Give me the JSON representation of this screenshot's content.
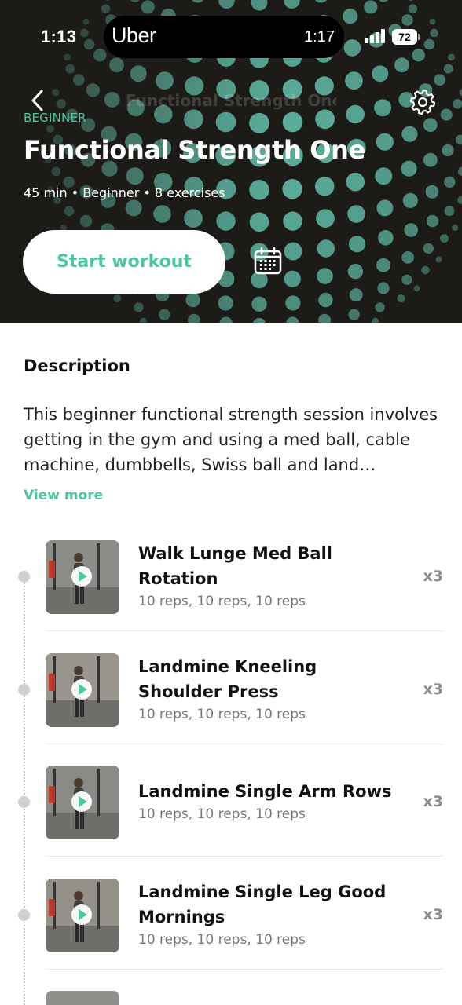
{
  "status_bar": {
    "time_left": "1:13",
    "app_logo": "Uber",
    "island_time": "1:17",
    "battery": "72"
  },
  "header": {
    "back_icon": "chevron-left-icon",
    "faded_title": "Functional Strength One",
    "settings_icon": "gear-icon"
  },
  "workout": {
    "level": "BEGINNER",
    "title": "Functional Strength One",
    "meta": "45 min • Beginner • 8 exercises",
    "start_label": "Start workout",
    "calendar_icon": "calendar-icon"
  },
  "description": {
    "heading": "Description",
    "text": "This beginner functional strength session involves getting in the gym and using a med ball, cable machine, dumbbells, Swiss ball and land…",
    "view_more": "View more"
  },
  "exercises": [
    {
      "name": "Walk Lunge Med Ball Rotation",
      "reps": "10 reps, 10 reps, 10 reps",
      "sets": "x3"
    },
    {
      "name": "Landmine Kneeling Shoulder Press",
      "reps": "10 reps, 10 reps, 10 reps",
      "sets": "x3"
    },
    {
      "name": "Landmine Single Arm Rows",
      "reps": "10 reps, 10 reps, 10 reps",
      "sets": "x3"
    },
    {
      "name": "Landmine Single Leg Good Mornings",
      "reps": "10 reps, 10 reps, 10 reps",
      "sets": "x3"
    }
  ],
  "colors": {
    "accent": "#4cc79b",
    "hero_bg": "#1c1b17",
    "dot_pattern": "#5fb5a2"
  }
}
